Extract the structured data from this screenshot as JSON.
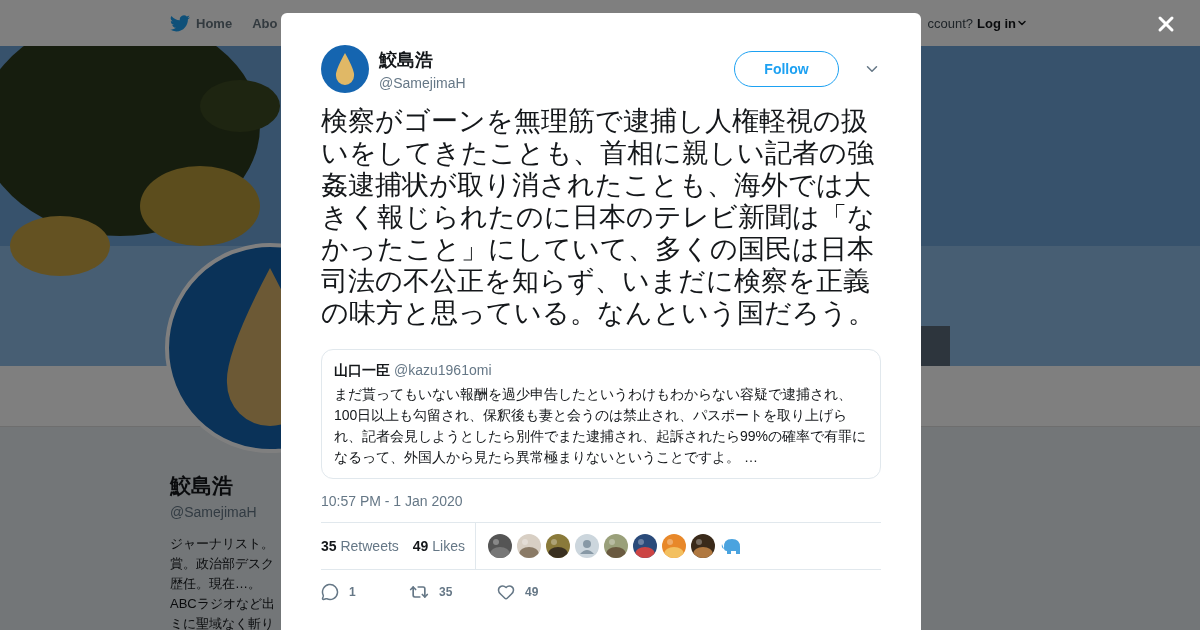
{
  "top_nav": {
    "items": [
      {
        "label": "Home",
        "kind": "home"
      },
      {
        "label": "Abo",
        "kind": "plain"
      }
    ],
    "account_prompt": "ccount?",
    "login": "Log in"
  },
  "profile": {
    "name": "鮫島浩",
    "handle": "@SamejimaH",
    "bio_lines": [
      "ジャーナリスト。",
      "賞。政治部デスク",
      "歴任。現在…。",
      "ABCラジオなど出",
      "ミに聖域なく斬り"
    ]
  },
  "tweet": {
    "author": {
      "name": "鮫島浩",
      "handle": "@SamejimaH"
    },
    "follow_button": "Follow",
    "text": "検察がゴーンを無理筋で逮捕し人権軽視の扱いをしてきたことも、首相に親しい記者の強姦逮捕状が取り消されたことも、海外では大きく報じられたのに日本のテレビ新聞は「なかったこと」にしていて、多くの国民は日本司法の不公正を知らず、いまだに検察を正義の味方と思っている。なんという国だろう。",
    "quote": {
      "name": "山口一臣",
      "handle": "@kazu1961omi",
      "text": "まだ貰ってもいない報酬を過少申告したというわけもわからない容疑で逮捕され、100日以上も勾留され、保釈後も妻と会うのは禁止され、パスポートを取り上げられ、記者会見しようとしたら別件でまた逮捕され、起訴されたら99%の確率で有罪になるって、外国人から見たら異常極まりないということですよ。 …"
    },
    "time": "10:57 PM - 1 Jan 2020",
    "stats": [
      {
        "count": "35",
        "label": "Retweets"
      },
      {
        "count": "49",
        "label": "Likes"
      }
    ],
    "likers": [
      {
        "kind": "picture"
      },
      {
        "kind": "picture"
      },
      {
        "kind": "picture"
      },
      {
        "kind": "default"
      },
      {
        "kind": "picture"
      },
      {
        "kind": "picture"
      },
      {
        "kind": "picture"
      },
      {
        "kind": "picture"
      },
      {
        "kind": "elephant"
      }
    ],
    "actions": [
      {
        "kind": "reply",
        "count": "1"
      },
      {
        "kind": "retweet",
        "count": "35"
      },
      {
        "kind": "like",
        "count": "49"
      }
    ]
  }
}
